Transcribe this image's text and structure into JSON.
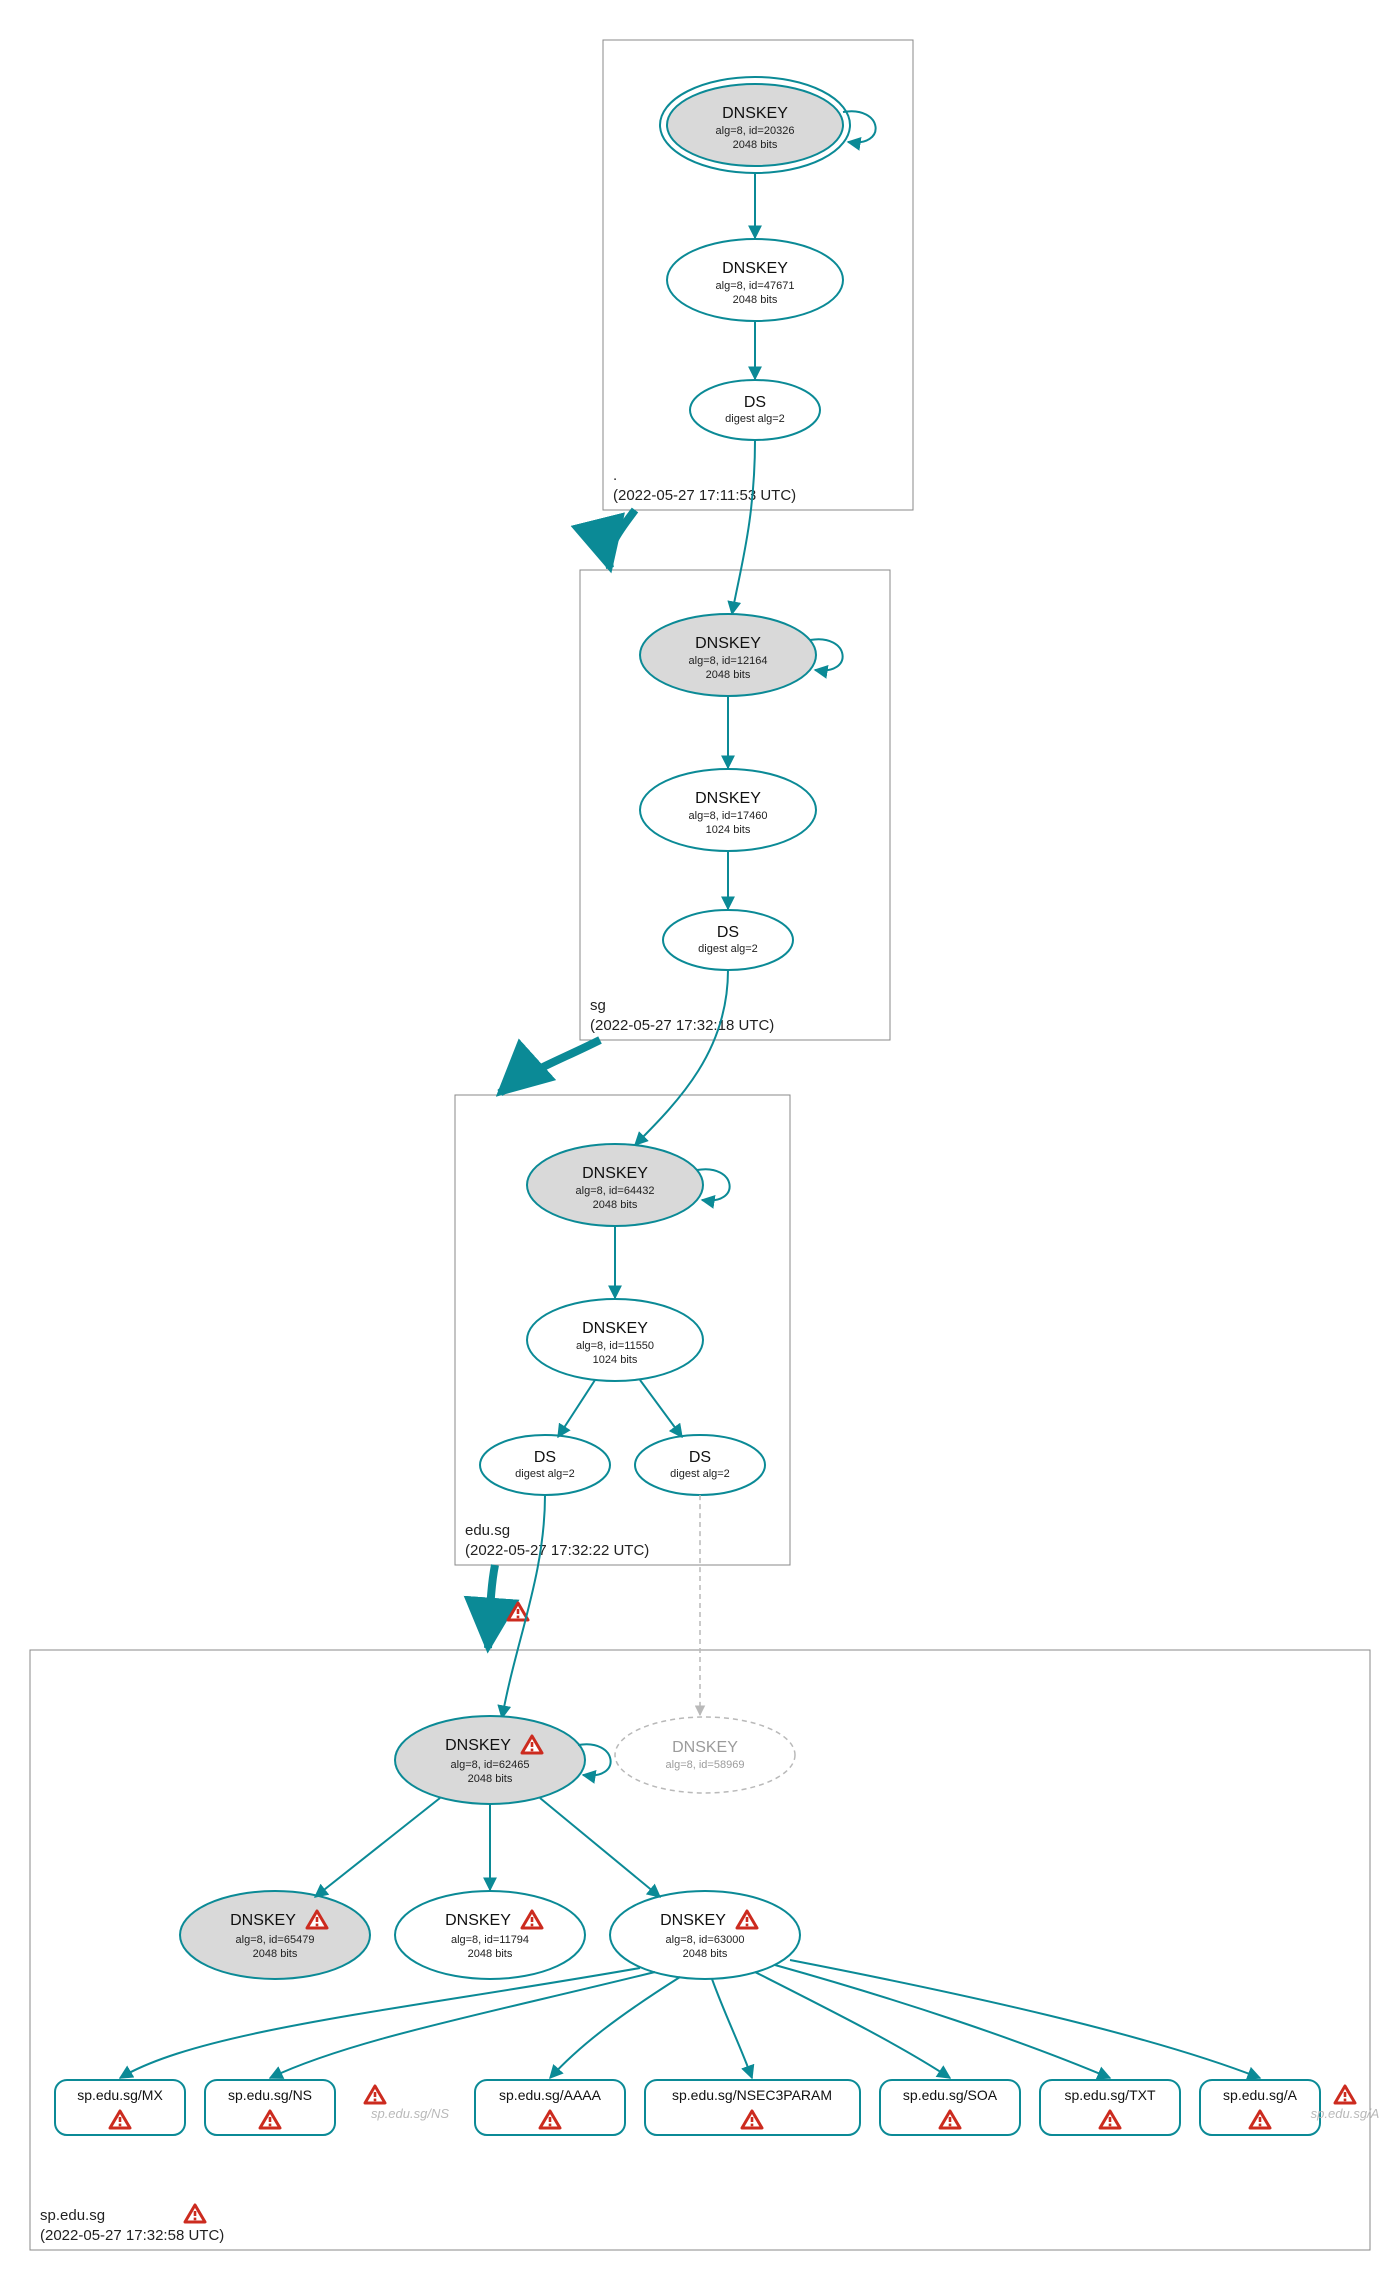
{
  "zones": {
    "root": {
      "label": ".",
      "timestamp": "(2022-05-27 17:11:53 UTC)"
    },
    "sg": {
      "label": "sg",
      "timestamp": "(2022-05-27 17:32:18 UTC)"
    },
    "edu_sg": {
      "label": "edu.sg",
      "timestamp": "(2022-05-27 17:32:22 UTC)"
    },
    "sp_edu_sg": {
      "label": "sp.edu.sg",
      "timestamp": "(2022-05-27 17:32:58 UTC)"
    }
  },
  "nodes": {
    "root_ksk": {
      "title": "DNSKEY",
      "l1": "alg=8, id=20326",
      "l2": "2048 bits"
    },
    "root_zsk": {
      "title": "DNSKEY",
      "l1": "alg=8, id=47671",
      "l2": "2048 bits"
    },
    "root_ds": {
      "title": "DS",
      "l1": "digest alg=2"
    },
    "sg_ksk": {
      "title": "DNSKEY",
      "l1": "alg=8, id=12164",
      "l2": "2048 bits"
    },
    "sg_zsk": {
      "title": "DNSKEY",
      "l1": "alg=8, id=17460",
      "l2": "1024 bits"
    },
    "sg_ds": {
      "title": "DS",
      "l1": "digest alg=2"
    },
    "edu_ksk": {
      "title": "DNSKEY",
      "l1": "alg=8, id=64432",
      "l2": "2048 bits"
    },
    "edu_zsk": {
      "title": "DNSKEY",
      "l1": "alg=8, id=11550",
      "l2": "1024 bits"
    },
    "edu_ds1": {
      "title": "DS",
      "l1": "digest alg=2"
    },
    "edu_ds2": {
      "title": "DS",
      "l1": "digest alg=2"
    },
    "sp_ksk": {
      "title": "DNSKEY",
      "l1": "alg=8, id=62465",
      "l2": "2048 bits"
    },
    "sp_missing": {
      "title": "DNSKEY",
      "l1": "alg=8, id=58969"
    },
    "sp_key1": {
      "title": "DNSKEY",
      "l1": "alg=8, id=65479",
      "l2": "2048 bits"
    },
    "sp_key2": {
      "title": "DNSKEY",
      "l1": "alg=8, id=11794",
      "l2": "2048 bits"
    },
    "sp_key3": {
      "title": "DNSKEY",
      "l1": "alg=8, id=63000",
      "l2": "2048 bits"
    }
  },
  "records": {
    "mx": "sp.edu.sg/MX",
    "ns": "sp.edu.sg/NS",
    "ns_dim": "sp.edu.sg/NS",
    "aaaa": "sp.edu.sg/AAAA",
    "nsec3param": "sp.edu.sg/NSEC3PARAM",
    "soa": "sp.edu.sg/SOA",
    "txt": "sp.edu.sg/TXT",
    "a": "sp.edu.sg/A",
    "a_dim": "sp.edu.sg/A"
  }
}
